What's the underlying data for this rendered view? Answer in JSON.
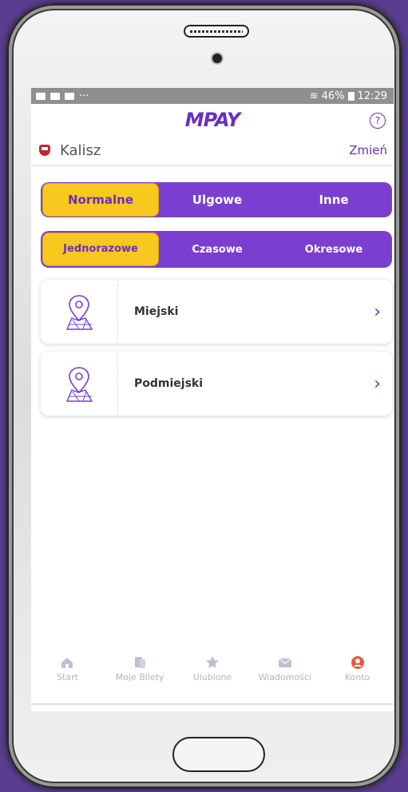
{
  "status": {
    "battery": "46%",
    "time": "12:29"
  },
  "app": {
    "logo": "MPAY",
    "help": "?"
  },
  "city": {
    "name": "Kalisz",
    "change_label": "Zmień"
  },
  "tariff_tabs": [
    {
      "label": "Normalne",
      "active": true
    },
    {
      "label": "Ulgowe",
      "active": false
    },
    {
      "label": "Inne",
      "active": false
    }
  ],
  "ticket_tabs": [
    {
      "label": "Jednorazowe",
      "active": true
    },
    {
      "label": "Czasowe",
      "active": false
    },
    {
      "label": "Okresowe",
      "active": false
    }
  ],
  "zones": [
    {
      "label": "Miejski",
      "icon": "map-pin-icon"
    },
    {
      "label": "Podmiejski",
      "icon": "map-pin-icon"
    }
  ],
  "nav": [
    {
      "label": "Start",
      "icon": "home-icon"
    },
    {
      "label": "Moje Bilety",
      "icon": "tickets-icon"
    },
    {
      "label": "Ulubione",
      "icon": "star-icon"
    },
    {
      "label": "Wiadomości",
      "icon": "envelope-icon"
    },
    {
      "label": "Konto",
      "icon": "account-icon"
    }
  ],
  "colors": {
    "accent": "#7a3ed0",
    "highlight": "#f7c81e",
    "konto_icon": "#e8573b"
  }
}
